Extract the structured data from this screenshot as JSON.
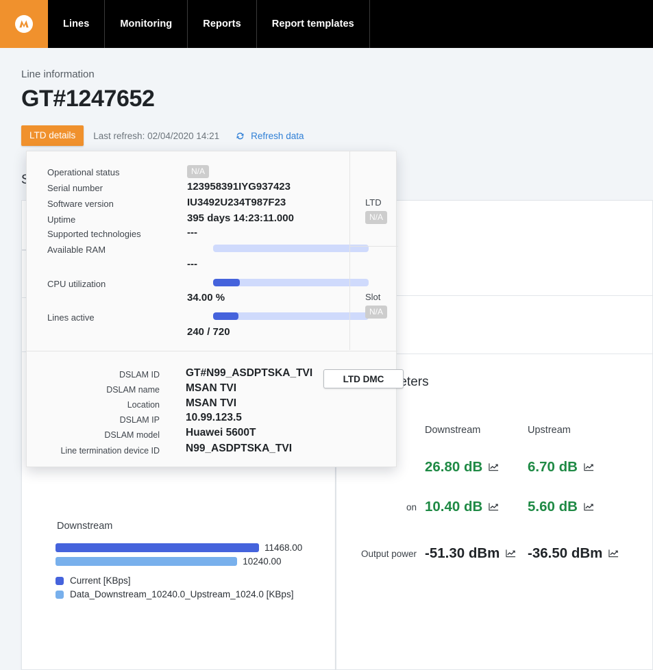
{
  "nav": {
    "logo_icon": "network-logo-icon",
    "items": [
      {
        "label": "Lines"
      },
      {
        "label": "Monitoring"
      },
      {
        "label": "Reports"
      },
      {
        "label": "Report templates"
      }
    ]
  },
  "header": {
    "breadcrumb": "Line information",
    "title": "GT#1247652",
    "ltd_details_label": "LTD details",
    "last_refresh": "Last refresh: 02/04/2020 14:21",
    "refresh_label": "Refresh data",
    "refresh_icon": "refresh-icon"
  },
  "background": {
    "left_section_title": "S",
    "right_section_title": "l parameters"
  },
  "physical_parameters": {
    "columns": [
      "",
      "Downstream",
      "Upstream"
    ],
    "rows": [
      {
        "label": "",
        "downstream": "26.80 dB",
        "upstream": "6.70 dB",
        "tone": "green"
      },
      {
        "label": "on",
        "downstream": "10.40 dB",
        "upstream": "5.60 dB",
        "tone": "green"
      },
      {
        "label": "Output power",
        "downstream": "-51.30 dBm",
        "upstream": "-36.50 dBm",
        "tone": "dark"
      }
    ],
    "spark_icon": "sparkline-chart-icon"
  },
  "chart_data": {
    "type": "bar",
    "title": "Downstream",
    "orientation": "horizontal",
    "categories": [
      "Current [KBps]",
      "Data_Downstream_10240.0_Upstream_1024.0 [KBps]"
    ],
    "values": [
      11468.0,
      10240.0
    ],
    "value_labels": [
      "11468.00",
      "10240.00"
    ],
    "colors": [
      "#4563dc",
      "#78b0ec"
    ],
    "xlim": [
      0,
      12000
    ],
    "grid": false,
    "legend_position": "bottom-left",
    "legend": [
      {
        "label": "Current [KBps]",
        "color": "#4563dc"
      },
      {
        "label": "Data_Downstream_10240.0_Upstream_1024.0 [KBps]",
        "color": "#78b0ec"
      }
    ]
  },
  "popup": {
    "stats": [
      {
        "label": "Operational status",
        "value": "N/A",
        "kind": "badge"
      },
      {
        "label": "Serial number",
        "value": "123958391IYG937423",
        "kind": "text"
      },
      {
        "label": "Software version",
        "value": "IU3492U234T987F23",
        "kind": "text"
      },
      {
        "label": "Uptime",
        "value": "395 days 14:23:11.000",
        "kind": "text"
      },
      {
        "label": "Supported technologies",
        "value": "---",
        "kind": "text"
      },
      {
        "label": "Available RAM",
        "value": "---",
        "kind": "meter",
        "percent": 0
      },
      {
        "label": "CPU utilization",
        "value": "34.00 %",
        "kind": "meter",
        "percent": 17
      },
      {
        "label": "Lines active",
        "value": "240 / 720",
        "kind": "meter",
        "percent": 16.5
      }
    ],
    "side": [
      {
        "label": "LTD",
        "value": "N/A"
      },
      {
        "label": "Slot",
        "value": "N/A"
      }
    ],
    "dslam": [
      {
        "label": "DSLAM ID",
        "value": "GT#N99_ASDPTSKA_TVI"
      },
      {
        "label": "DSLAM name",
        "value": "MSAN TVI"
      },
      {
        "label": "Location",
        "value": "MSAN TVI"
      },
      {
        "label": "DSLAM IP",
        "value": "10.99.123.5"
      },
      {
        "label": "DSLAM model",
        "value": "Huawei 5600T"
      },
      {
        "label": "Line termination device ID",
        "value": "N99_ASDPTSKA_TVI"
      }
    ],
    "dmc_button_label": "LTD DMC"
  },
  "colors": {
    "brand_orange": "#f0912d",
    "nav_black": "#000000",
    "link_blue": "#2f7fd6",
    "meter_fill": "#4563dc",
    "meter_track": "#cfdafc",
    "bar_current": "#4563dc",
    "bar_profile": "#78b0ec",
    "value_green": "#1f8a45",
    "page_bg": "#f2f5f8"
  }
}
